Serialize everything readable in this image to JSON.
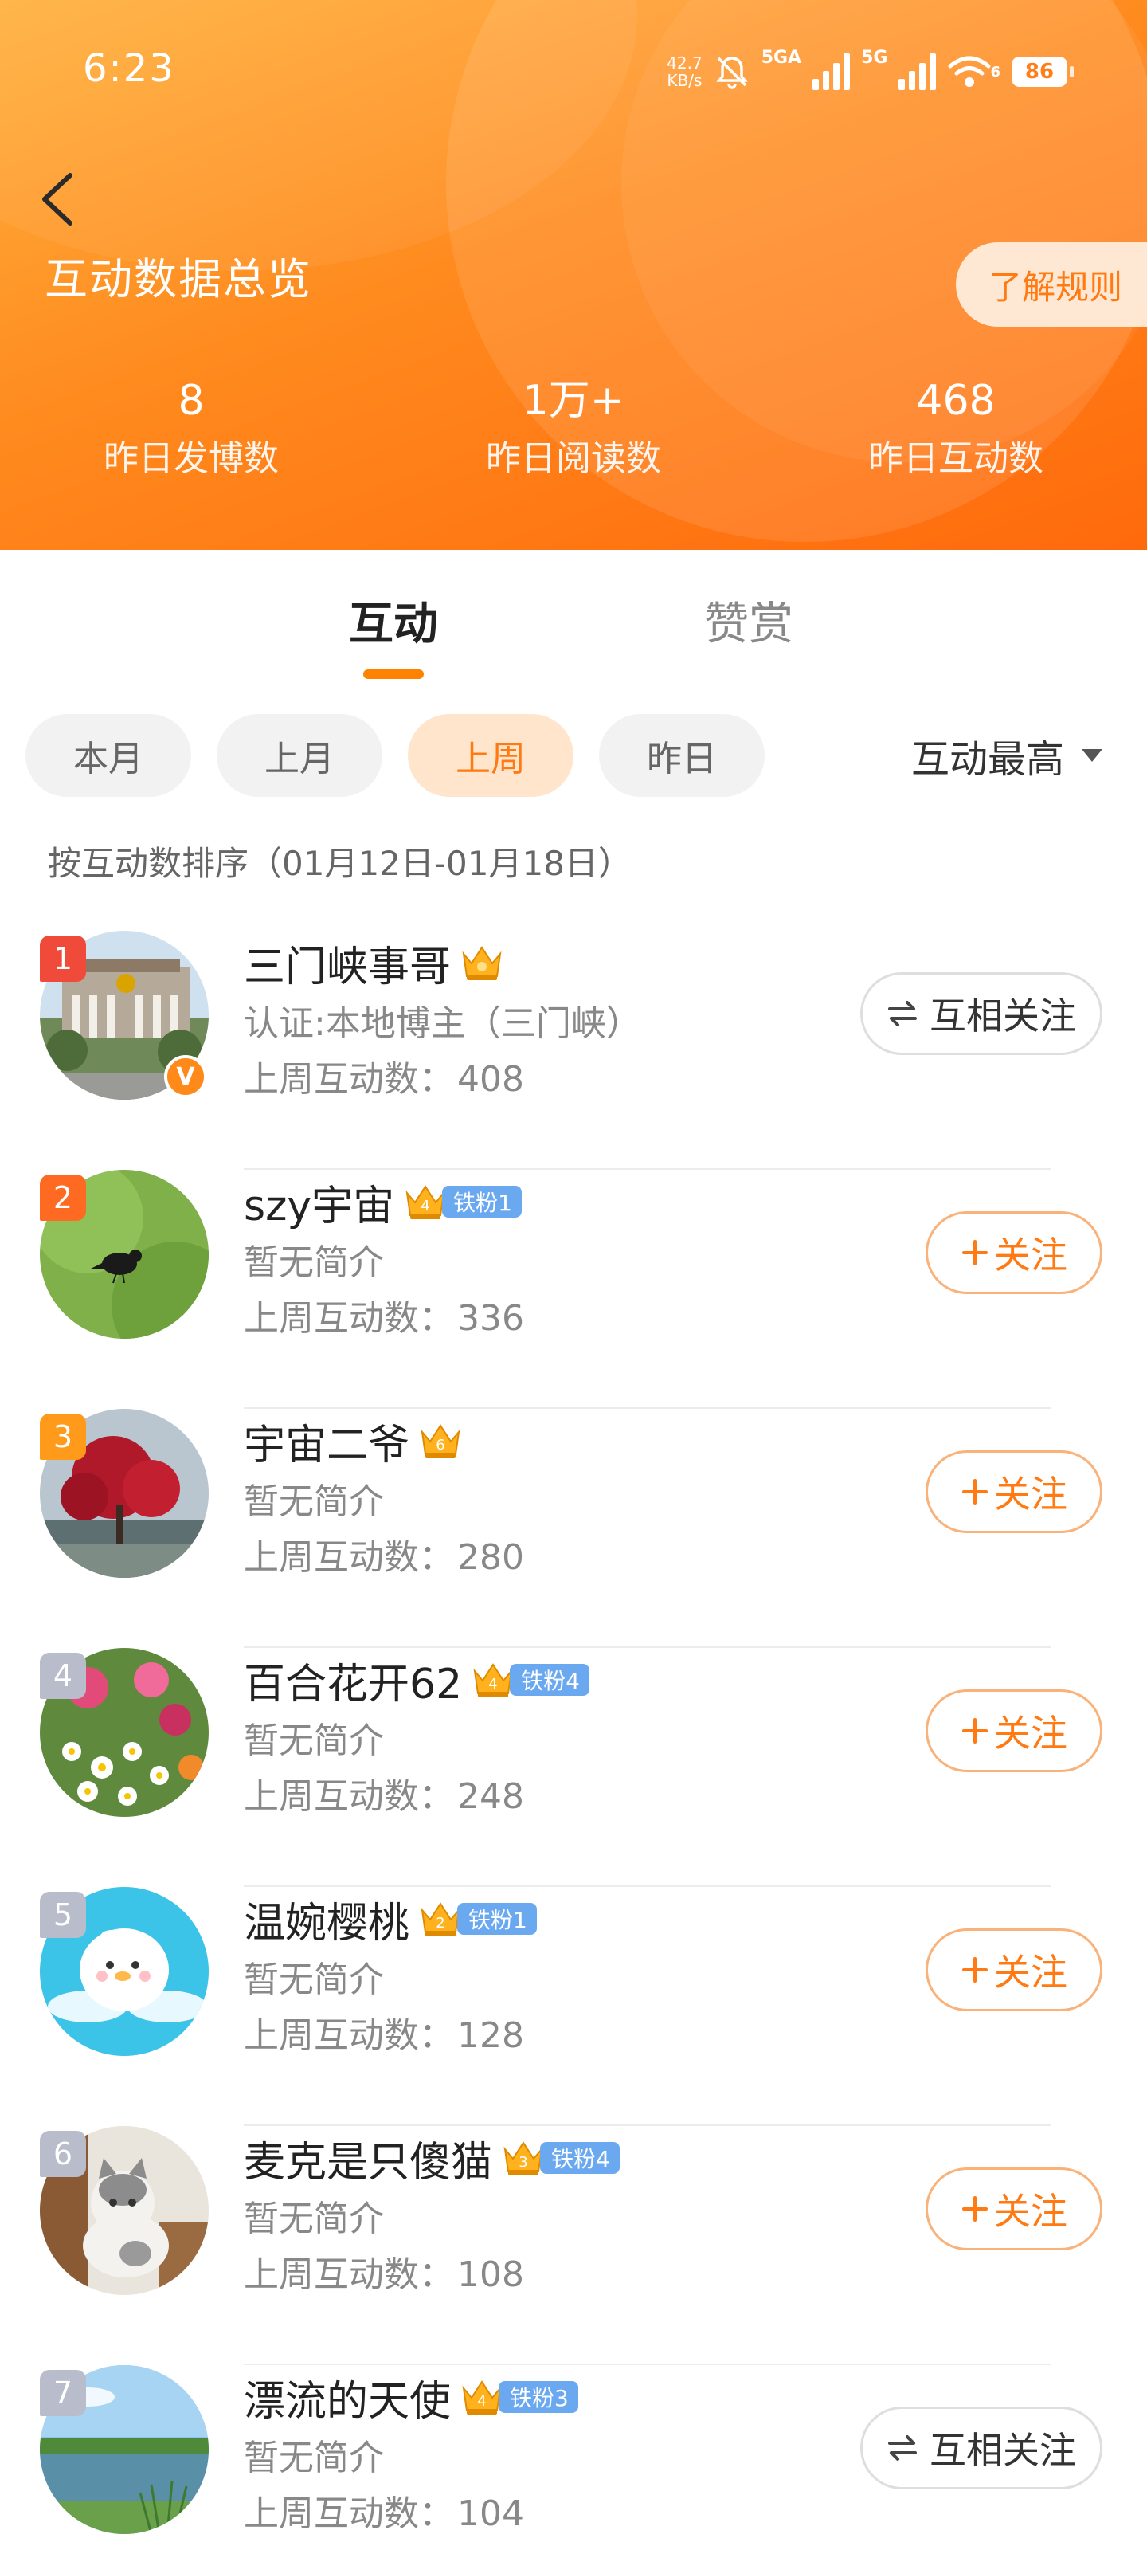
{
  "status_bar": {
    "time": "6:23",
    "net_speed_value": "42.7",
    "net_speed_unit": "KB/s",
    "signal1_label": "5GA",
    "signal2_label": "5G",
    "wifi_label": "6",
    "battery": "86",
    "icons": [
      "bell-muted-icon",
      "signal-icon",
      "wifi-icon",
      "battery-icon"
    ]
  },
  "header": {
    "title": "互动数据总览",
    "rules_button": "了解规则",
    "stats": [
      {
        "value": "8",
        "label": "昨日发博数"
      },
      {
        "value": "1万+",
        "label": "昨日阅读数"
      },
      {
        "value": "468",
        "label": "昨日互动数"
      }
    ]
  },
  "tabs": {
    "active": "互动",
    "inactive": "赞赏"
  },
  "filters": {
    "chips": [
      "本月",
      "上月",
      "上周",
      "昨日"
    ],
    "selected": "上周",
    "sort_label": "互动最高"
  },
  "sort_note": "按互动数排序（01月12日-01月18日）",
  "list": {
    "count_label": "上周互动数：",
    "items": [
      {
        "rank": "1",
        "name": "三门峡事哥",
        "crown_level": "",
        "fan_badge": "",
        "desc": "认证:本地博主（三门峡）",
        "count": "408",
        "button": "互相关注",
        "button_type": "mutual",
        "verified": true
      },
      {
        "rank": "2",
        "name": "szy宇宙",
        "crown_level": "4",
        "fan_badge": "铁粉1",
        "desc": "暂无简介",
        "count": "336",
        "button": "关注",
        "button_type": "follow",
        "verified": false
      },
      {
        "rank": "3",
        "name": "宇宙二爷",
        "crown_level": "6",
        "fan_badge": "",
        "desc": "暂无简介",
        "count": "280",
        "button": "关注",
        "button_type": "follow",
        "verified": false
      },
      {
        "rank": "4",
        "name": "百合花开62",
        "crown_level": "4",
        "fan_badge": "铁粉4",
        "desc": "暂无简介",
        "count": "248",
        "button": "关注",
        "button_type": "follow",
        "verified": false
      },
      {
        "rank": "5",
        "name": "温婉樱桃",
        "crown_level": "2",
        "fan_badge": "铁粉1",
        "desc": "暂无简介",
        "count": "128",
        "button": "关注",
        "button_type": "follow",
        "verified": false
      },
      {
        "rank": "6",
        "name": "麦克是只傻猫",
        "crown_level": "3",
        "fan_badge": "铁粉4",
        "desc": "暂无简介",
        "count": "108",
        "button": "关注",
        "button_type": "follow",
        "verified": false
      },
      {
        "rank": "7",
        "name": "漂流的天使",
        "crown_level": "4",
        "fan_badge": "铁粉3",
        "desc": "暂无简介",
        "count": "104",
        "button": "互相关注",
        "button_type": "mutual",
        "verified": false
      }
    ]
  },
  "colors": {
    "accent": "#ff8200",
    "rank_1": "#f04a3a",
    "rank_2": "#ff6a22",
    "rank_3": "#ff9a1a",
    "rank_other": "#b8bccb",
    "fan_badge": "#6aa8f0"
  }
}
